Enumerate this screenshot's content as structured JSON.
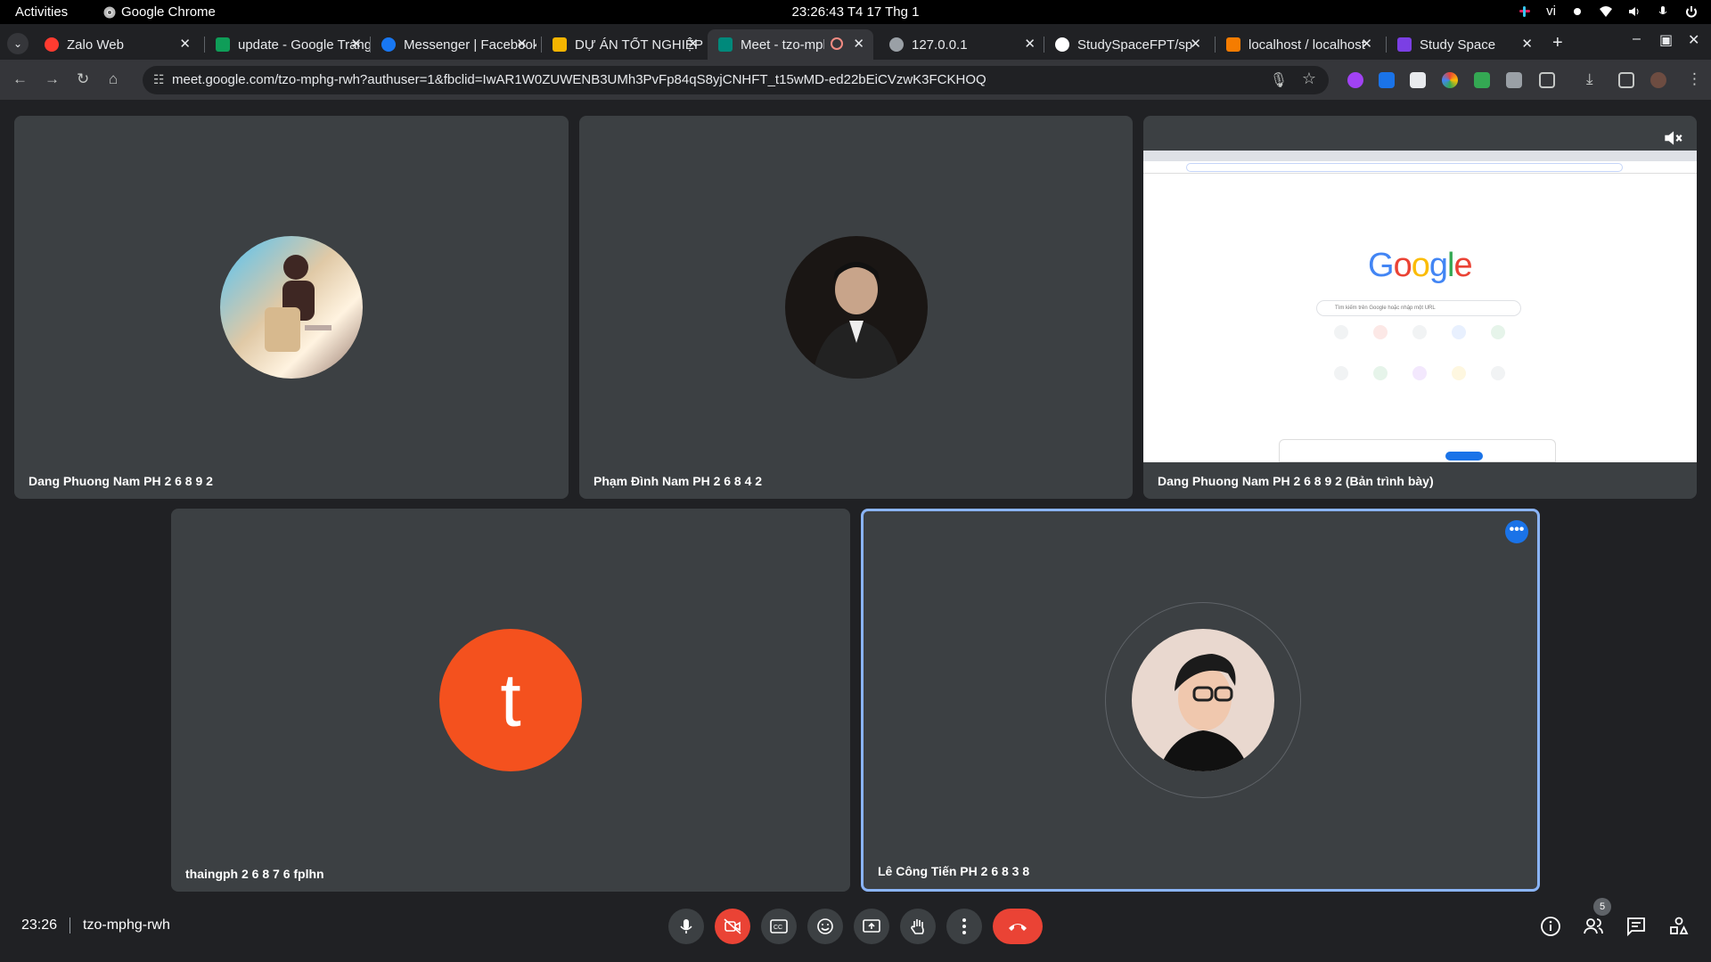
{
  "system": {
    "activities": "Activities",
    "app_name": "Google Chrome",
    "clock": "23:26:43  T4 17 Thg 1",
    "language": "vi"
  },
  "tabs": [
    {
      "title": "Zalo Web",
      "favicon": "zalo-icon",
      "color": "#ff3b30"
    },
    {
      "title": "update - Google Trang tính",
      "favicon": "sheets-icon",
      "color": "#0f9d58"
    },
    {
      "title": "Messenger | Facebook",
      "favicon": "messenger-icon",
      "color": "#1877f2"
    },
    {
      "title": "DỰ ÁN TỐT NGHIỆP",
      "favicon": "slides-icon",
      "color": "#f4b400"
    },
    {
      "title": "Meet - tzo-mphg-rwh",
      "favicon": "meet-icon",
      "color": "#00897b",
      "active": true
    },
    {
      "title": "127.0.0.1",
      "favicon": "globe-icon",
      "color": "#9aa0a6"
    },
    {
      "title": "StudySpaceFPT/sp",
      "favicon": "github-icon",
      "color": "#ffffff"
    },
    {
      "title": "localhost / localhost",
      "favicon": "phpmyadmin-icon",
      "color": "#f57c00"
    },
    {
      "title": "Study Space",
      "favicon": "studyspace-icon",
      "color": "#7b3fe4"
    }
  ],
  "toolbar": {
    "url": "meet.google.com/tzo-mphg-rwh?authuser=1&fbclid=IwAR1W0ZUWENB3UMh3PvFp84qS8yjCNHFT_t15wMD-ed22bEiCVzwK3FCKHOQ"
  },
  "participants": [
    {
      "name": "Dang Phuong Nam PH 2 6 8 9 2"
    },
    {
      "name": "Phạm Đình Nam PH 2 6 8 4 2"
    },
    {
      "name": "Dang Phuong Nam PH 2 6 8 9 2 (Bản trình bày)"
    },
    {
      "name": "thaingph 2 6 8 7 6 fplhn",
      "initial": "t",
      "avatar_color": "#f4511e"
    },
    {
      "name": "Lê Công Tiến PH 2 6 8 3 8"
    }
  ],
  "presentation": {
    "logo": "Google",
    "search_placeholder": "Tìm kiếm trên Google hoặc nhập một URL"
  },
  "meeting": {
    "time": "23:26",
    "code": "tzo-mphg-rwh",
    "participant_count": "5"
  }
}
